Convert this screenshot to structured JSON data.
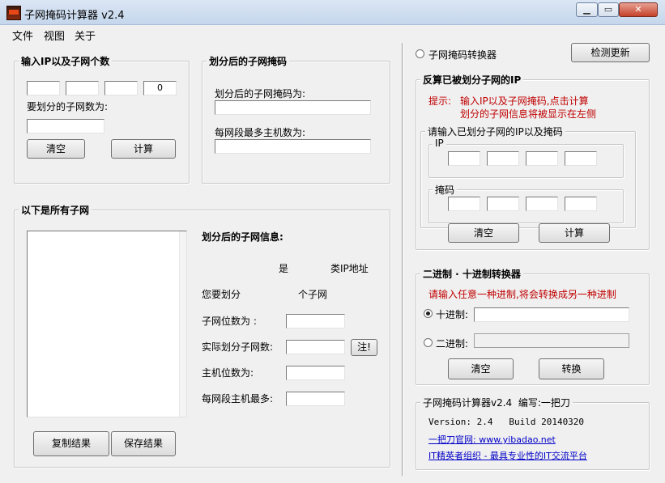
{
  "window": {
    "title": "子网掩码计算器 v2.4",
    "min_glyph": "▁",
    "max_glyph": "▭",
    "close_glyph": "✕"
  },
  "menu": [
    "文件",
    "视图",
    "关于"
  ],
  "input_group": {
    "legend": "输入IP以及子网个数",
    "ip_octets": [
      "",
      "",
      "",
      "0"
    ],
    "subnet_count_label": "要划分的子网数为:",
    "subnet_count_value": "",
    "clear_label": "清空",
    "calc_label": "计算"
  },
  "mask_group": {
    "legend": "划分后的子网掩码",
    "mask_label": "划分后的子网掩码为:",
    "mask_value": "",
    "hosts_label": "每网段最多主机数为:",
    "hosts_value": ""
  },
  "subnets_group": {
    "legend": "以下是所有子网",
    "info_title": "划分后的子网信息:",
    "is_text": "是",
    "class_ip_text": "类IP地址",
    "you_divide_text": "您要划分",
    "subnets_count_text": "个子网",
    "subnet_bits_label": "子网位数为 :",
    "actual_subnets_label": "实际划分子网数:",
    "note_button": "注!",
    "host_bits_label": "主机位数为:",
    "max_hosts_label": "每网段主机最多:",
    "copy_label": "复制结果",
    "save_label": "保存结果"
  },
  "reverse_section": {
    "radio_label": "子网掩码转换器",
    "update_label": "检测更新",
    "legend": "反算已被划分子网的IP",
    "hint_prefix": "提示:",
    "hint_line1": "输入IP以及子网掩码,点击计算",
    "hint_line2": "划分的子网信息将被显示在左侧",
    "inner_legend": "请输入已划分子网的IP以及掩码",
    "ip_legend": "IP",
    "mask_legend": "掩码",
    "clear_label": "清空",
    "calc_label": "计算"
  },
  "converter": {
    "legend": "二进制 · 十进制转换器",
    "hint": "请输入任意一种进制,将会转换成另一种进制",
    "decimal_label": "十进制:",
    "binary_label": "二进制:",
    "decimal_value": "",
    "binary_value": "",
    "clear_label": "清空",
    "convert_label": "转换"
  },
  "about": {
    "legend": "子网掩码计算器v2.4  编写:一把刀",
    "version": "Version: 2.4   Build 20140320",
    "site_link": "一把刀官网: www.yibadao.net",
    "org_link": "IT精英者组织 - 最具专业性的IT交流平台"
  },
  "colors": {
    "hint_red": "#c00000",
    "link_blue": "#0000c8"
  }
}
